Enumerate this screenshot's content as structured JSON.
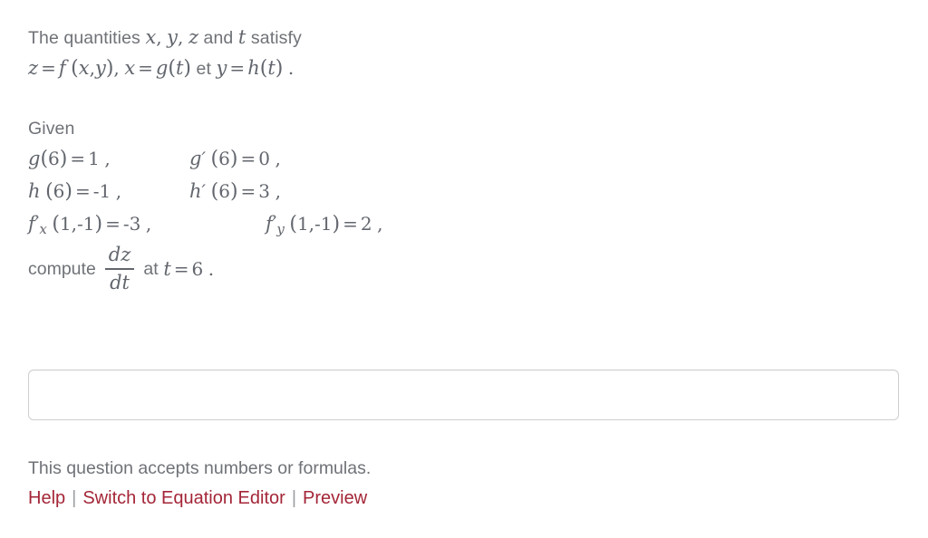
{
  "question": {
    "statement": {
      "line1": {
        "intro": "The quantities",
        "var_x": "x",
        "comma1": ",",
        "var_y": "y",
        "comma2": ",",
        "var_z": "z",
        "conjunction": "and",
        "var_t": "t",
        "verb": "satisfy"
      },
      "line2": {
        "z": "z",
        "eq1": "=",
        "f": "f",
        "open1": "(",
        "x1": "x",
        "comma_inner": ",",
        "y1": "y",
        "close1": ")",
        "comma_mid": ",",
        "x2": "x",
        "eq2": "=",
        "g": "g",
        "open2": "(",
        "t1": "t",
        "close2": ")",
        "et": "et",
        "y2": "y",
        "eq3": "=",
        "h": "h",
        "open3": "(",
        "t2": "t",
        "close3": ")",
        "period": "."
      }
    },
    "given": {
      "label": "Given",
      "rows": [
        {
          "left": {
            "fn": "g",
            "prime": "",
            "open": "(",
            "arg": "6",
            "close": ")",
            "eq": "=",
            "value": "1",
            "trail": ","
          },
          "right": {
            "fn": "g",
            "prime": "′",
            "open": "(",
            "arg": "6",
            "close": ")",
            "eq": "=",
            "value": "0",
            "trail": ","
          }
        },
        {
          "left": {
            "fn": "h",
            "prime": "",
            "open": "(",
            "arg": "6",
            "close": ")",
            "eq": "=",
            "value": "-1",
            "trail": ","
          },
          "right": {
            "fn": "h",
            "prime": "′",
            "open": "(",
            "arg": "6",
            "close": ")",
            "eq": "=",
            "value": "3",
            "trail": ","
          }
        },
        {
          "left": {
            "fn": "f",
            "prime": "′",
            "sub": "x",
            "open": "(",
            "arg": "1,-1",
            "close": ")",
            "eq": "=",
            "value": "-3",
            "trail": ","
          },
          "right": {
            "fn": "f",
            "prime": "′",
            "sub": "y",
            "open": "(",
            "arg": "1,-1",
            "close": ")",
            "eq": "=",
            "value": "2",
            "trail": ","
          }
        }
      ]
    },
    "compute": {
      "word": "compute",
      "fraction_numerator": "dz",
      "fraction_denominator": "dt",
      "at_word": "at",
      "at_var": "t",
      "at_eq": "=",
      "at_value": "6",
      "period": "."
    }
  },
  "answer": {
    "value": "",
    "placeholder": ""
  },
  "footer": {
    "accepts_note": "This question accepts numbers or formulas.",
    "links": [
      {
        "label": "Help",
        "name": "help-link"
      },
      {
        "label": "Switch to Equation Editor",
        "name": "switch-to-equation-editor-link"
      },
      {
        "label": "Preview",
        "name": "preview-link"
      }
    ],
    "separator": "|"
  },
  "colors": {
    "page_background": "#ffffff",
    "prose_text": "#6f7277",
    "math_text": "#62666d",
    "link_red": "#a42638",
    "separator_gray": "#9a9da1",
    "input_border": "#cfcfcf"
  }
}
